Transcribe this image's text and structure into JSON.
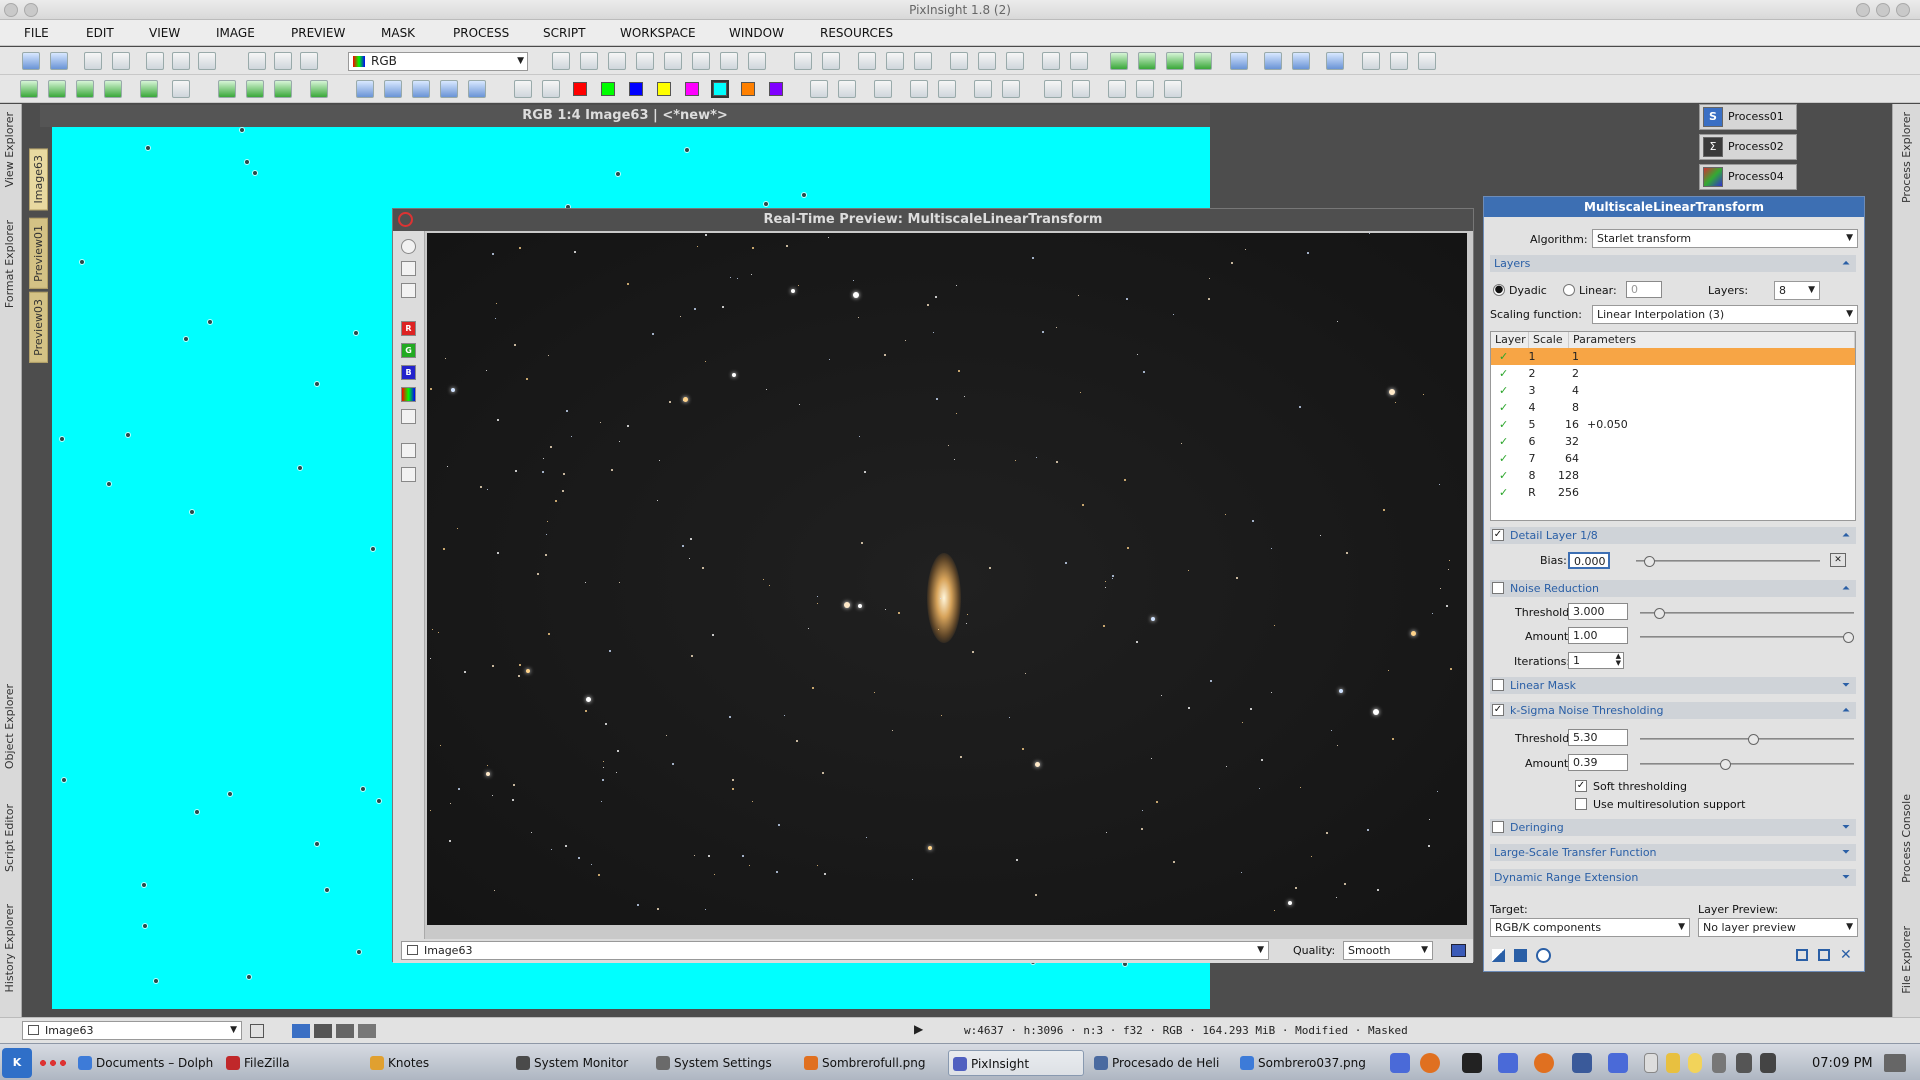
{
  "app": {
    "title": "PixInsight 1.8 (2)"
  },
  "menu": [
    "FILE",
    "EDIT",
    "VIEW",
    "IMAGE",
    "PREVIEW",
    "MASK",
    "PROCESS",
    "SCRIPT",
    "WORKSPACE",
    "WINDOW",
    "RESOURCES"
  ],
  "toolbar": {
    "color_mode": "RGB"
  },
  "left_tabs": {
    "view_explorer": "View Explorer",
    "format_explorer": "Format Explorer",
    "object_explorer": "Object Explorer",
    "script_editor": "Script Editor",
    "history_explorer": "History Explorer"
  },
  "preview_tabs": {
    "image": "Image63",
    "preview01": "Preview01",
    "preview03": "Preview03"
  },
  "right_tabs": {
    "process_explorer": "Process Explorer",
    "process_console": "Process Console",
    "file_explorer": "File Explorer"
  },
  "image_window": {
    "title": "RGB 1:4 Image63 | <*new*>"
  },
  "realtime_preview": {
    "title": "Real-Time Preview: MultiscaleLinearTransform",
    "view": "Image63",
    "quality_label": "Quality:",
    "quality": "Smooth"
  },
  "process_icons": [
    {
      "label": "Process01",
      "icon_color": "#3a6fc4"
    },
    {
      "label": "Process02",
      "icon_color": "#3a3a3a"
    },
    {
      "label": "Process04",
      "icon_color": "#5a8a3a"
    }
  ],
  "mlt": {
    "title": "MultiscaleLinearTransform",
    "algorithm_label": "Algorithm:",
    "algorithm": "Starlet transform",
    "layers_section": "Layers",
    "dyadic": "Dyadic",
    "linear": "Linear:",
    "linear_value": "0",
    "layers_label": "Layers:",
    "layers_value": "8",
    "scaling_label": "Scaling function:",
    "scaling": "Linear Interpolation (3)",
    "table_headers": [
      "Layer",
      "Scale",
      "Parameters"
    ],
    "rows": [
      {
        "layer": "1",
        "scale": "1",
        "params": "",
        "selected": true
      },
      {
        "layer": "2",
        "scale": "2",
        "params": ""
      },
      {
        "layer": "3",
        "scale": "4",
        "params": ""
      },
      {
        "layer": "4",
        "scale": "8",
        "params": ""
      },
      {
        "layer": "5",
        "scale": "16",
        "params": "+0.050"
      },
      {
        "layer": "6",
        "scale": "32",
        "params": ""
      },
      {
        "layer": "7",
        "scale": "64",
        "params": ""
      },
      {
        "layer": "8",
        "scale": "128",
        "params": ""
      },
      {
        "layer": "R",
        "scale": "256",
        "params": ""
      }
    ],
    "detail_section": "Detail Layer 1/8",
    "bias_label": "Bias:",
    "bias": "0.000",
    "noise_section": "Noise Reduction",
    "nr_threshold_label": "Threshold:",
    "nr_threshold": "3.000",
    "nr_amount_label": "Amount:",
    "nr_amount": "1.00",
    "nr_iterations_label": "Iterations:",
    "nr_iterations": "1",
    "linear_mask_section": "Linear Mask",
    "ksigma_section": "k-Sigma Noise Thresholding",
    "ks_threshold_label": "Threshold:",
    "ks_threshold": "5.30",
    "ks_amount_label": "Amount:",
    "ks_amount": "0.39",
    "soft_thresholding": "Soft thresholding",
    "use_multires": "Use multiresolution support",
    "deringing_section": "Deringing",
    "lstf_section": "Large-Scale Transfer Function",
    "dre_section": "Dynamic Range Extension",
    "target_label": "Target:",
    "target": "RGB/K components",
    "layer_preview_label": "Layer Preview:",
    "layer_preview": "No layer preview"
  },
  "statusbar": {
    "view": "Image63",
    "info": "w:4637 · h:3096 · n:3 · f32 · RGB · 164.293 MiB · Modified · Masked"
  },
  "taskbar": {
    "items": [
      {
        "label": "Documents – Dolph",
        "color": "#3d7bd8"
      },
      {
        "label": "FileZilla",
        "color": "#c0282a"
      },
      {
        "label": "Knotes",
        "color": "#e0a030"
      },
      {
        "label": "System Monitor",
        "color": "#4a4a4a"
      },
      {
        "label": "System Settings",
        "color": "#6a6a6a"
      },
      {
        "label": "Sombrerofull.png",
        "color": "#e07020"
      },
      {
        "label": "PixInsight",
        "color": "#5060c0",
        "active": true
      },
      {
        "label": "Procesado de Heli",
        "color": "#4a6aa0"
      },
      {
        "label": "Sombrero037.png",
        "color": "#3d7bd8"
      }
    ],
    "clock": "07:09 PM"
  }
}
